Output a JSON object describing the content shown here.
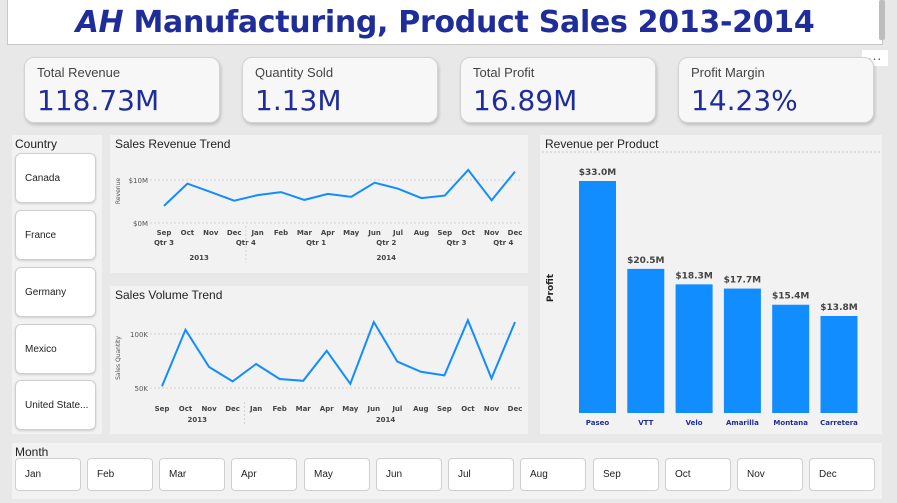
{
  "header": {
    "title_prefix": "AH",
    "title_rest": " Manufacturing, Product Sales 2013-2014",
    "more_label": "..."
  },
  "kpis": [
    {
      "label": "Total Revenue",
      "value": "118.73M"
    },
    {
      "label": "Quantity Sold",
      "value": "1.13M"
    },
    {
      "label": "Total Profit",
      "value": "16.89M"
    },
    {
      "label": "Profit Margin",
      "value": "14.23%"
    }
  ],
  "country_slicer": {
    "title": "Country",
    "items": [
      "Canada",
      "France",
      "Germany",
      "Mexico",
      "United State..."
    ]
  },
  "month_slicer": {
    "title": "Month",
    "items": [
      "Jan",
      "Feb",
      "Mar",
      "Apr",
      "May",
      "Jun",
      "Jul",
      "Aug",
      "Sep",
      "Oct",
      "Nov",
      "Dec"
    ]
  },
  "colors": {
    "accent": "#118dff",
    "title": "#1f2d9a"
  },
  "chart_data": [
    {
      "type": "line",
      "title": "Sales Revenue Trend",
      "ylabel": "Revenue",
      "yticks": [
        "$0M",
        "$10M"
      ],
      "ylim": [
        0,
        14
      ],
      "x": [
        "Sep",
        "Oct",
        "Nov",
        "Dec",
        "Jan",
        "Feb",
        "Mar",
        "Apr",
        "May",
        "Jun",
        "Jul",
        "Aug",
        "Sep",
        "Oct",
        "Nov",
        "Dec"
      ],
      "quarters": [
        "Qtr 3",
        "Qtr 4",
        "Qtr 1",
        "Qtr 2",
        "Qtr 3",
        "Qtr 4"
      ],
      "years": [
        "2013",
        "2014"
      ],
      "series": [
        {
          "values": [
            4,
            9.2,
            7.2,
            5.2,
            6.5,
            7.2,
            5.4,
            6.8,
            6.1,
            9.4,
            8.0,
            5.8,
            6.4,
            12.4,
            5.3,
            12.0
          ]
        }
      ]
    },
    {
      "type": "line",
      "title": "Sales Volume Trend",
      "ylabel": "Sales Quantity",
      "yticks": [
        "50K",
        "100K"
      ],
      "ylim": [
        40000,
        110000
      ],
      "x": [
        "Sep",
        "Oct",
        "Nov",
        "Dec",
        "Jan",
        "Feb",
        "Mar",
        "Apr",
        "May",
        "Jun",
        "Jul",
        "Aug",
        "Sep",
        "Oct",
        "Nov",
        "Dec"
      ],
      "years": [
        "2013",
        "2014"
      ],
      "series": [
        {
          "values": [
            49000,
            96000,
            65000,
            53000,
            67500,
            55000,
            53500,
            78500,
            51000,
            102500,
            69500,
            61000,
            58000,
            104000,
            55500,
            102500
          ]
        }
      ]
    },
    {
      "type": "bar",
      "title": "Revenue per Product",
      "ylabel": "Profit",
      "categories": [
        "Paseo",
        "VTT",
        "Velo",
        "Amarilla",
        "Montana",
        "Carretera"
      ],
      "values": [
        33.0,
        20.5,
        18.3,
        17.7,
        15.4,
        13.8
      ],
      "labels": [
        "$33.0M",
        "$20.5M",
        "$18.3M",
        "$17.7M",
        "$15.4M",
        "$13.8M"
      ],
      "ylim": [
        0,
        33
      ]
    }
  ]
}
